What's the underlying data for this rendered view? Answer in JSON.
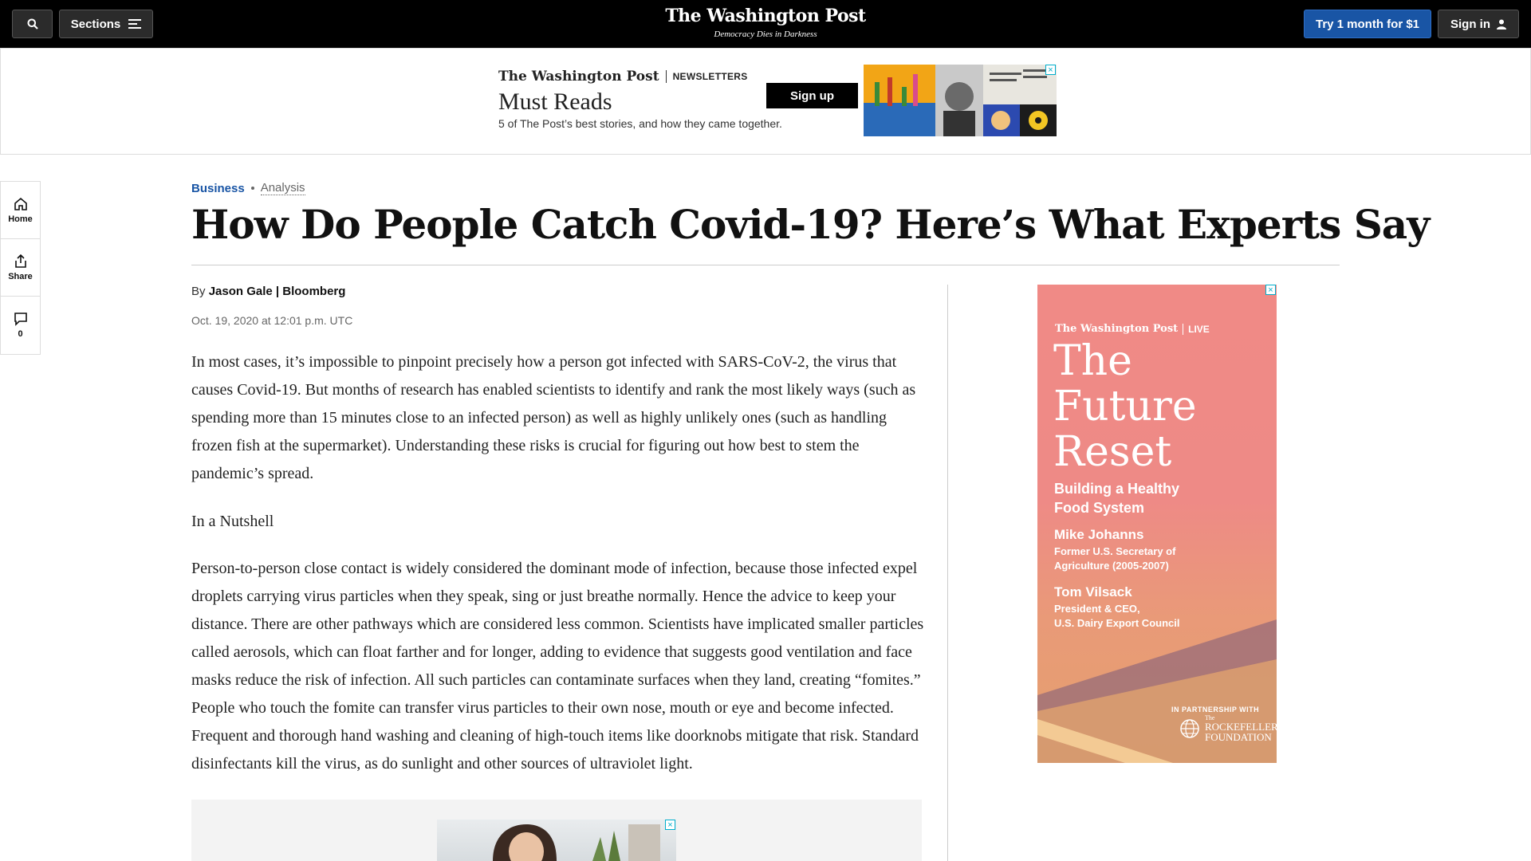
{
  "topbar": {
    "sections_label": "Sections",
    "masthead": "The Washington Post",
    "tagline": "Democracy Dies in Darkness",
    "try_label": "Try 1 month for $1",
    "signin_label": "Sign in"
  },
  "newsletter_ad": {
    "logo": "The Washington Post",
    "tag": "NEWSLETTERS",
    "title": "Must Reads",
    "description": "5 of The Post’s best stories, and how they came together.",
    "signup_label": "Sign up"
  },
  "rail": {
    "home_label": "Home",
    "share_label": "Share",
    "comments_count": "0"
  },
  "article": {
    "section": "Business",
    "label": "Analysis",
    "headline": "How Do People Catch Covid-19? Here’s What Experts Say",
    "by": "By",
    "author": "Jason Gale | Bloomberg",
    "date": "Oct. 19, 2020 at 12:01 p.m. UTC",
    "paragraphs": [
      "In most cases, it’s impossible to pinpoint precisely how a person got infected with SARS-CoV-2, the virus that causes Covid-19. But months of research has enabled scientists to identify and rank the most likely ways (such as spending more than 15 minutes close to an infected person) as well as highly unlikely ones (such as handling frozen fish at the supermarket). Understanding these risks is crucial for figuring out how best to stem the pandemic’s spread.",
      "In a Nutshell",
      "Person-to-person close contact is widely considered the dominant mode of infection, because those infected expel droplets carrying virus particles when they speak, sing or just breathe normally. Hence the advice to keep your distance. There are other pathways which are considered less common. Scientists have implicated smaller particles called aerosols, which can float farther and for longer, adding to evidence that suggests good ventilation and face masks reduce the risk of infection. All such particles can contaminate surfaces when they land, creating “fomites.” People who touch the fomite can transfer virus particles to their own nose, mouth or eye and become infected. Frequent and thorough hand washing and cleaning of high-touch items like doorknobs mitigate that risk. Standard disinfectants kill the virus, as do sunlight and other sources of ultraviolet light."
    ]
  },
  "side_ad": {
    "logo": "The Washington Post",
    "live": "LIVE",
    "title_lines": [
      "The",
      "Future",
      "Reset"
    ],
    "subtitle_lines": [
      "Building a Healthy",
      "Food System"
    ],
    "speakers": [
      {
        "name": "Mike Johanns",
        "role_lines": [
          "Former U.S. Secretary of",
          "Agriculture (2005-2007)"
        ]
      },
      {
        "name": "Tom Vilsack",
        "role_lines": [
          "President & CEO,",
          "U.S. Dairy Export Council"
        ]
      }
    ],
    "partner_label": "IN PARTNERSHIP WITH",
    "partner_small": "The",
    "partner_name_lines": [
      "ROCKEFELLER",
      "FOUNDATION"
    ]
  },
  "colors": {
    "accent": "#1955a5",
    "topbar": "#000000",
    "ad_pink": "#f08a86"
  },
  "icons": [
    "search-icon",
    "menu-icon",
    "user-icon",
    "home-icon",
    "share-icon",
    "comment-icon",
    "ad-close-icon"
  ]
}
